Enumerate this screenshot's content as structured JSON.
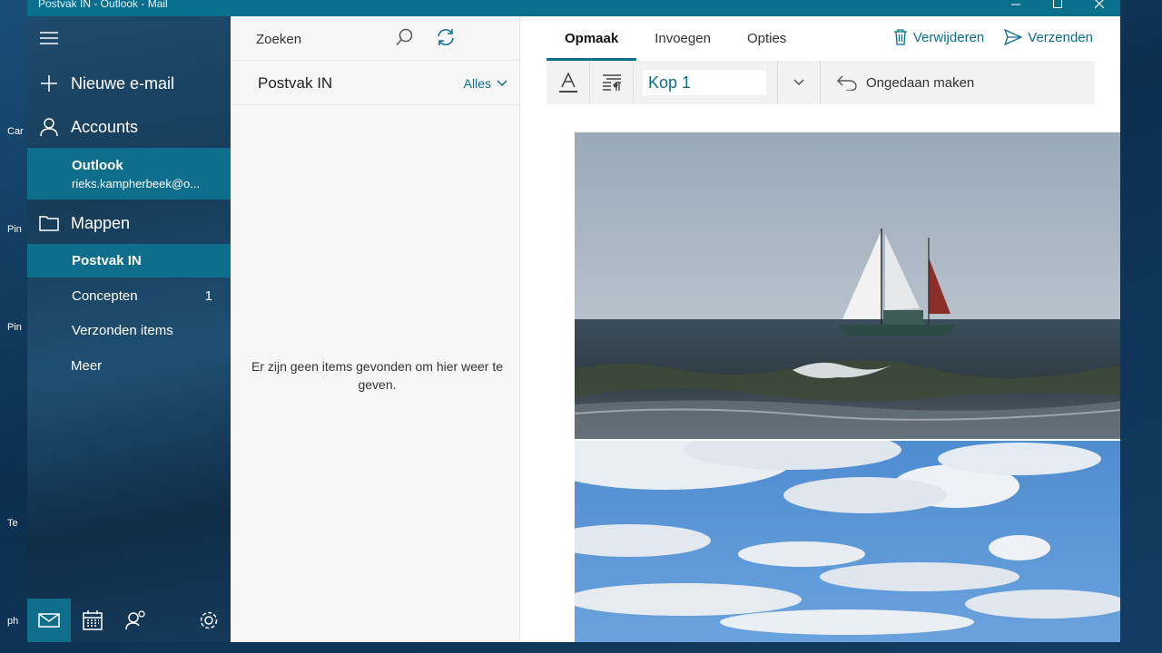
{
  "window": {
    "title": "Postvak IN - Outlook - Mail"
  },
  "desktop": {
    "labels": [
      "Car",
      "Pin",
      "Pin",
      "Te",
      "ph"
    ]
  },
  "nav": {
    "new_mail": "Nieuwe e-mail",
    "accounts": "Accounts",
    "account": {
      "name": "Outlook",
      "email": "rieks.kampherbeek@o..."
    },
    "folders_label": "Mappen",
    "folders": [
      {
        "label": "Postvak IN",
        "count": "",
        "selected": true
      },
      {
        "label": "Concepten",
        "count": "1",
        "selected": false
      },
      {
        "label": "Verzonden items",
        "count": "",
        "selected": false
      },
      {
        "label": "Meer",
        "count": "",
        "selected": false
      }
    ]
  },
  "list": {
    "search_placeholder": "Zoeken",
    "inbox_title": "Postvak IN",
    "filter": "Alles",
    "empty_message": "Er zijn geen items gevonden om hier weer te geven."
  },
  "compose": {
    "tabs": [
      "Opmaak",
      "Invoegen",
      "Opties"
    ],
    "active_tab": "Opmaak",
    "delete_label": "Verwijderen",
    "send_label": "Verzenden",
    "style_value": "Kop 1",
    "undo_label": "Ongedaan maken"
  },
  "colors": {
    "accent": "#0a6e8d",
    "selected_bg": "#0f6e8c"
  }
}
